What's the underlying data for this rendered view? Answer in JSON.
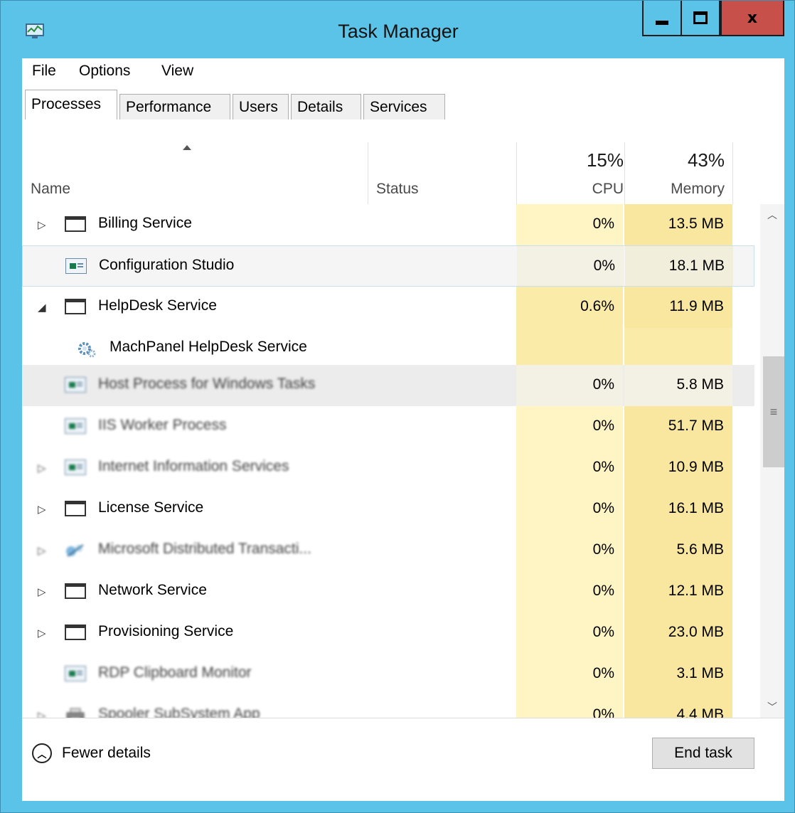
{
  "window": {
    "title": "Task Manager",
    "icon": "task-manager-icon",
    "controls": {
      "minimize": "minimize-icon",
      "maximize": "maximize-icon",
      "close_label": "x"
    },
    "accent": "#5cc3e8",
    "close_color": "#c7504b"
  },
  "menu": {
    "items": [
      "File",
      "Options",
      "View"
    ]
  },
  "tabs": [
    "Processes",
    "Performance",
    "Users",
    "Details",
    "Services"
  ],
  "active_tab": "Processes",
  "columns": {
    "name": "Name",
    "status": "Status",
    "cpu": {
      "label": "CPU",
      "total": "15%"
    },
    "memory": {
      "label": "Memory",
      "total": "43%"
    }
  },
  "processes": [
    {
      "expander": "▷",
      "icon": "window-icon",
      "name": "Billing Service",
      "status": "",
      "cpu": "0%",
      "memory": "13.5 MB"
    },
    {
      "expander": "",
      "icon": "app-icon",
      "name": "Configuration Studio",
      "status": "",
      "cpu": "0%",
      "memory": "18.1 MB"
    },
    {
      "expander": "◢",
      "icon": "window-icon",
      "name": "HelpDesk Service",
      "status": "",
      "cpu": "0.6%",
      "memory": "11.9 MB"
    },
    {
      "expander": "",
      "icon": "gear-icon",
      "name": "MachPanel HelpDesk Service",
      "status": "",
      "cpu": "",
      "memory": ""
    },
    {
      "expander": "",
      "icon": "app-icon",
      "name": "Host Process for Windows Tasks",
      "status": "",
      "cpu": "0%",
      "memory": "5.8 MB"
    },
    {
      "expander": "",
      "icon": "app-icon",
      "name": "IIS Worker Process",
      "status": "",
      "cpu": "0%",
      "memory": "51.7 MB"
    },
    {
      "expander": "▷",
      "icon": "app-icon",
      "name": "Internet Information Services",
      "status": "",
      "cpu": "0%",
      "memory": "10.9 MB"
    },
    {
      "expander": "▷",
      "icon": "window-icon",
      "name": "License Service",
      "status": "",
      "cpu": "0%",
      "memory": "16.1 MB"
    },
    {
      "expander": "▷",
      "icon": "transaction-icon",
      "name": "Microsoft Distributed Transacti...",
      "status": "",
      "cpu": "0%",
      "memory": "5.6 MB"
    },
    {
      "expander": "▷",
      "icon": "window-icon",
      "name": "Network Service",
      "status": "",
      "cpu": "0%",
      "memory": "12.1 MB"
    },
    {
      "expander": "▷",
      "icon": "window-icon",
      "name": "Provisioning Service",
      "status": "",
      "cpu": "0%",
      "memory": "23.0 MB"
    },
    {
      "expander": "",
      "icon": "app-icon",
      "name": "RDP Clipboard Monitor",
      "status": "",
      "cpu": "0%",
      "memory": "3.1 MB"
    },
    {
      "expander": "▷",
      "icon": "printer-icon",
      "name": "Spooler SubSystem App",
      "status": "",
      "cpu": "0%",
      "memory": "4.4 MB"
    }
  ],
  "footer": {
    "fewer_details": "Fewer details",
    "end_task": "End task"
  }
}
